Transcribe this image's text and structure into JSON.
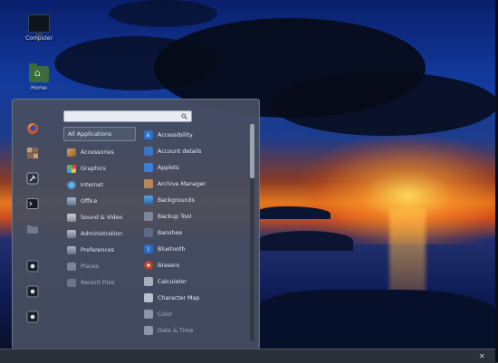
{
  "desktop": {
    "icons": [
      {
        "label": "Computer",
        "icon": "computer-icon"
      },
      {
        "label": "Home",
        "icon": "home-folder-icon"
      }
    ]
  },
  "menu": {
    "search": {
      "value": "",
      "placeholder": ""
    },
    "sidebar": [
      {
        "icon": "firefox-icon"
      },
      {
        "icon": "software-manager-icon"
      },
      {
        "icon": "system-settings-icon"
      },
      {
        "icon": "terminal-icon"
      },
      {
        "icon": "files-icon"
      },
      {
        "icon": "lock-screen-icon"
      },
      {
        "icon": "logout-icon"
      },
      {
        "icon": "shutdown-icon"
      }
    ],
    "categories": [
      {
        "label": "All Applications",
        "selected": true
      },
      {
        "label": "Accessories"
      },
      {
        "label": "Graphics"
      },
      {
        "label": "Internet"
      },
      {
        "label": "Office"
      },
      {
        "label": "Sound & Video"
      },
      {
        "label": "Administration"
      },
      {
        "label": "Preferences"
      },
      {
        "label": "Places",
        "dim": true
      },
      {
        "label": "Recent Files",
        "dim": true
      }
    ],
    "apps": [
      {
        "label": "Accessibility"
      },
      {
        "label": "Account details"
      },
      {
        "label": "Applets"
      },
      {
        "label": "Archive Manager"
      },
      {
        "label": "Backgrounds"
      },
      {
        "label": "Backup Tool"
      },
      {
        "label": "Banshee"
      },
      {
        "label": "Bluetooth"
      },
      {
        "label": "Brasero"
      },
      {
        "label": "Calculator"
      },
      {
        "label": "Character Map"
      },
      {
        "label": "Color",
        "dim": true
      },
      {
        "label": "Date & Time",
        "dim": true
      }
    ]
  },
  "colors": {
    "menu_bg": "#464e60",
    "selection": "#4e586c",
    "panel": "#2c3038"
  }
}
